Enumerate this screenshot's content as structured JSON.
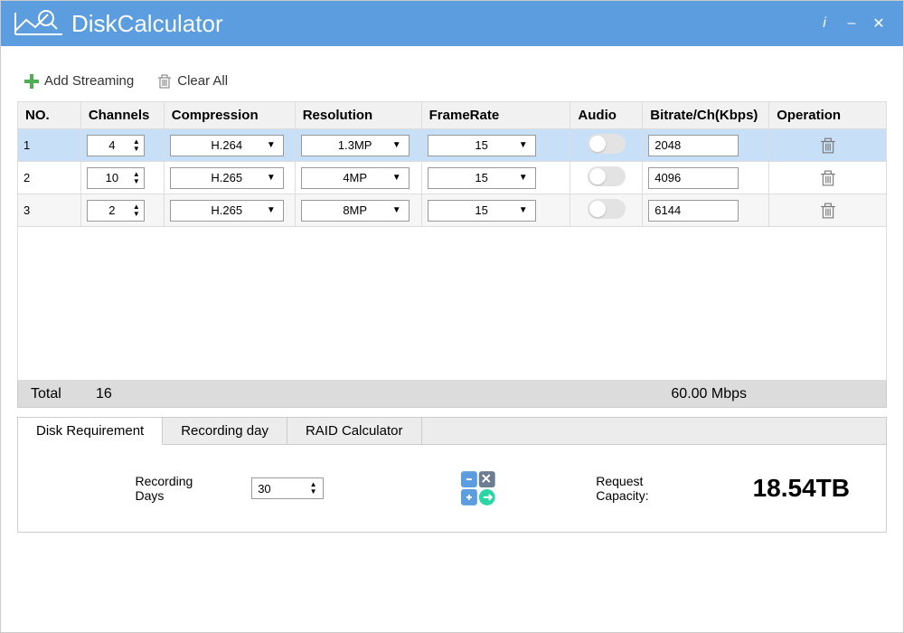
{
  "app": {
    "title_bold": "Disk",
    "title_light": "Calculator"
  },
  "toolbar": {
    "add": "Add Streaming",
    "clear": "Clear All"
  },
  "headers": {
    "no": "NO.",
    "channels": "Channels",
    "compression": "Compression",
    "resolution": "Resolution",
    "framerate": "FrameRate",
    "audio": "Audio",
    "bitrate": "Bitrate/Ch(Kbps)",
    "operation": "Operation"
  },
  "rows": [
    {
      "no": "1",
      "channels": "4",
      "compression": "H.264",
      "resolution": "1.3MP",
      "framerate": "15",
      "bitrate": "2048",
      "selected": true
    },
    {
      "no": "2",
      "channels": "10",
      "compression": "H.265",
      "resolution": "4MP",
      "framerate": "15",
      "bitrate": "4096",
      "selected": false
    },
    {
      "no": "3",
      "channels": "2",
      "compression": "H.265",
      "resolution": "8MP",
      "framerate": "15",
      "bitrate": "6144",
      "selected": false
    }
  ],
  "total": {
    "label": "Total",
    "channels": "16",
    "bitrate": "60.00 Mbps"
  },
  "tabs": {
    "t0": "Disk Requirement",
    "t1": "Recording day",
    "t2": "RAID Calculator"
  },
  "panel": {
    "rec_days_label": "Recording Days",
    "rec_days": "30",
    "req_label": "Request Capacity:",
    "req_value": "18.54TB"
  }
}
